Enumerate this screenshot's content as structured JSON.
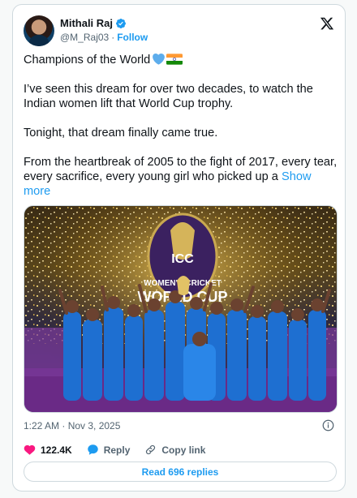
{
  "author": {
    "name": "Mithali Raj",
    "handle": "@M_Raj03",
    "separator": "·",
    "follow_label": "Follow"
  },
  "tweet": {
    "line1": "Champions of the World",
    "paragraph2": "I’ve seen this dream for over two decades, to watch the Indian women lift that World Cup trophy.",
    "paragraph3": "Tonight, that dream finally came true.",
    "paragraph4": "From the heartbreak of 2005 to the fight of 2017, every tear, every sacrifice, every young girl who picked up a",
    "show_more_label": "Show more"
  },
  "photo": {
    "logo_icc": "ICC",
    "logo_line1": "WOMEN'S CRICKET",
    "logo_line2": "WORLD CUP"
  },
  "meta": {
    "timestamp": "1:22 AM · Nov 3, 2025"
  },
  "actions": {
    "likes_count": "122.4K",
    "reply_label": "Reply",
    "copy_link_label": "Copy link"
  },
  "read_replies_label": "Read 696 replies",
  "icons": {
    "verified": "verified-badge-icon",
    "x_logo": "x-logo-icon",
    "heart": "heart-icon",
    "reply": "reply-bubble-icon",
    "link": "link-icon",
    "info": "info-icon",
    "blue_heart": "blue-heart-emoji",
    "india_flag": "india-flag-emoji"
  },
  "colors": {
    "accent": "#1d9bf0",
    "like": "#f91880",
    "text": "#0f1419",
    "muted": "#536471",
    "border": "#cfd9de",
    "jersey": "#1e6fd1"
  }
}
